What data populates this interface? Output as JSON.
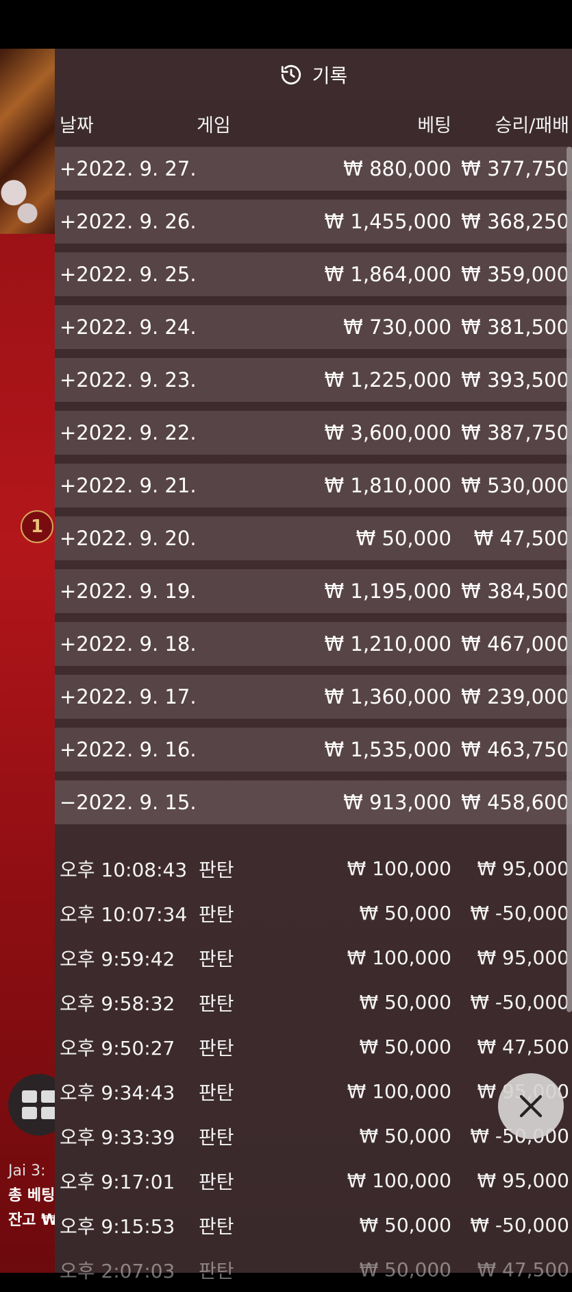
{
  "header": {
    "title": "기록",
    "icon": "history-clock-icon"
  },
  "columns": {
    "date": "날짜",
    "game": "게임",
    "bet": "베팅",
    "win_loss": "승리/패배"
  },
  "days": [
    {
      "date": "+2022. 9. 27.",
      "bet": "₩ 880,000",
      "win": "₩ 377,750"
    },
    {
      "date": "+2022. 9. 26.",
      "bet": "₩ 1,455,000",
      "win": "₩ 368,250"
    },
    {
      "date": "+2022. 9. 25.",
      "bet": "₩ 1,864,000",
      "win": "₩ 359,000"
    },
    {
      "date": "+2022. 9. 24.",
      "bet": "₩ 730,000",
      "win": "₩ 381,500"
    },
    {
      "date": "+2022. 9. 23.",
      "bet": "₩ 1,225,000",
      "win": "₩ 393,500"
    },
    {
      "date": "+2022. 9. 22.",
      "bet": "₩ 3,600,000",
      "win": "₩ 387,750"
    },
    {
      "date": "+2022. 9. 21.",
      "bet": "₩ 1,810,000",
      "win": "₩ 530,000"
    },
    {
      "date": "+2022. 9. 20.",
      "bet": "₩ 50,000",
      "win": "₩ 47,500"
    },
    {
      "date": "+2022. 9. 19.",
      "bet": "₩ 1,195,000",
      "win": "₩ 384,500"
    },
    {
      "date": "+2022. 9. 18.",
      "bet": "₩ 1,210,000",
      "win": "₩ 467,000"
    },
    {
      "date": "+2022. 9. 17.",
      "bet": "₩ 1,360,000",
      "win": "₩ 239,000"
    },
    {
      "date": "+2022. 9. 16.",
      "bet": "₩ 1,535,000",
      "win": "₩ 463,750"
    },
    {
      "date": "−2022. 9. 15.",
      "bet": "₩ 913,000",
      "win": "₩ 458,600"
    }
  ],
  "transactions": [
    {
      "time": "오후 10:08:43",
      "game": "판탄",
      "bet": "₩ 100,000",
      "win": "₩ 95,000"
    },
    {
      "time": "오후 10:07:34",
      "game": "판탄",
      "bet": "₩ 50,000",
      "win": "₩ -50,000"
    },
    {
      "time": "오후 9:59:42",
      "game": "판탄",
      "bet": "₩ 100,000",
      "win": "₩ 95,000"
    },
    {
      "time": "오후 9:58:32",
      "game": "판탄",
      "bet": "₩ 50,000",
      "win": "₩ -50,000"
    },
    {
      "time": "오후 9:50:27",
      "game": "판탄",
      "bet": "₩ 50,000",
      "win": "₩ 47,500"
    },
    {
      "time": "오후 9:34:43",
      "game": "판탄",
      "bet": "₩ 100,000",
      "win": "₩ 95,000"
    },
    {
      "time": "오후 9:33:39",
      "game": "판탄",
      "bet": "₩ 50,000",
      "win": "₩ -50,000"
    },
    {
      "time": "오후 9:17:01",
      "game": "판탄",
      "bet": "₩ 100,000",
      "win": "₩ 95,000"
    },
    {
      "time": "오후 9:15:53",
      "game": "판탄",
      "bet": "₩ 50,000",
      "win": "₩ -50,000"
    },
    {
      "time": "오후 2:07:03",
      "game": "판탄",
      "bet": "₩ 50,000",
      "win": "₩ 47,500"
    }
  ],
  "background": {
    "chip_label": "1",
    "info_line1": "Jai 3:",
    "info_line2": "총 베팅",
    "info_line3": "잔고 ₩"
  },
  "colors": {
    "panel": "#3c2a2c",
    "day_row": "#574446",
    "accent_gold": "#f2b632"
  }
}
